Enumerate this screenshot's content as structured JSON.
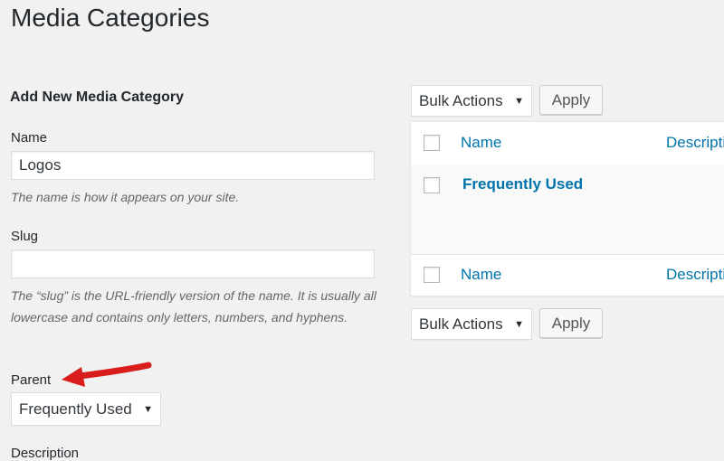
{
  "page": {
    "title": "Media Categories"
  },
  "form": {
    "heading": "Add New Media Category",
    "name": {
      "label": "Name",
      "value": "Logos",
      "help": "The name is how it appears on your site."
    },
    "slug": {
      "label": "Slug",
      "value": "",
      "help": "The “slug” is the URL-friendly version of the name. It is usually all lowercase and contains only letters, numbers, and hyphens."
    },
    "parent": {
      "label": "Parent",
      "selected": "Frequently Used"
    },
    "description": {
      "label": "Description"
    }
  },
  "table": {
    "top_bulk": {
      "selected": "Bulk Actions",
      "apply_label": "Apply"
    },
    "bottom_bulk": {
      "selected": "Bulk Actions",
      "apply_label": "Apply"
    },
    "columns": [
      "Name",
      "Description"
    ],
    "rows": [
      {
        "name": "Frequently Used",
        "description": ""
      }
    ]
  },
  "icons": {
    "caret": "▼"
  },
  "annotation": {
    "type": "red-arrow",
    "points_to": "Parent",
    "color": "#e01b1b"
  },
  "colors": {
    "link": "#0073aa",
    "background": "#f1f1f1"
  }
}
